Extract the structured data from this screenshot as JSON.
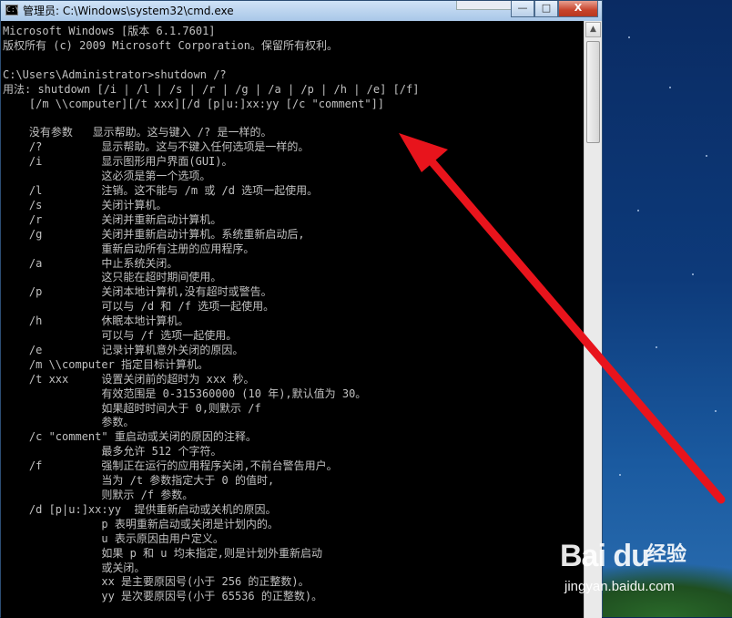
{
  "window": {
    "title": "管理员: C:\\Windows\\system32\\cmd.exe",
    "icon_label": "C:\\",
    "buttons": {
      "minimize": "—",
      "maximize": "□",
      "close": "X"
    }
  },
  "console": {
    "lines": [
      "Microsoft Windows [版本 6.1.7601]",
      "版权所有 (c) 2009 Microsoft Corporation。保留所有权利。",
      "",
      "C:\\Users\\Administrator>shutdown /?",
      "用法: shutdown [/i | /l | /s | /r | /g | /a | /p | /h | /e] [/f]",
      "    [/m \\\\computer][/t xxx][/d [p|u:]xx:yy [/c \"comment\"]]",
      "",
      "    没有参数   显示帮助。这与键入 /? 是一样的。",
      "    /?         显示帮助。这与不键入任何选项是一样的。",
      "    /i         显示图形用户界面(GUI)。",
      "               这必须是第一个选项。",
      "    /l         注销。这不能与 /m 或 /d 选项一起使用。",
      "    /s         关闭计算机。",
      "    /r         关闭并重新启动计算机。",
      "    /g         关闭并重新启动计算机。系统重新启动后,",
      "               重新启动所有注册的应用程序。",
      "    /a         中止系统关闭。",
      "               这只能在超时期间使用。",
      "    /p         关闭本地计算机,没有超时或警告。",
      "               可以与 /d 和 /f 选项一起使用。",
      "    /h         休眠本地计算机。",
      "               可以与 /f 选项一起使用。",
      "    /e         记录计算机意外关闭的原因。",
      "    /m \\\\computer 指定目标计算机。",
      "    /t xxx     设置关闭前的超时为 xxx 秒。",
      "               有效范围是 0-315360000 (10 年),默认值为 30。",
      "               如果超时时间大于 0,则默示 /f",
      "               参数。",
      "    /c \"comment\" 重启动或关闭的原因的注释。",
      "               最多允许 512 个字符。",
      "    /f         强制正在运行的应用程序关闭,不前台警告用户。",
      "               当为 /t 参数指定大于 0 的值时,",
      "               则默示 /f 参数。",
      "    /d [p|u:]xx:yy  提供重新启动或关机的原因。",
      "               p 表明重新启动或关闭是计划内的。",
      "               u 表示原因由用户定义。",
      "               如果 p 和 u 均未指定,则是计划外重新启动",
      "               或关闭。",
      "               xx 是主要原因号(小于 256 的正整数)。",
      "               yy 是次要原因号(小于 65536 的正整数)。"
    ]
  },
  "watermark": {
    "logo": "Bai du",
    "cn": "经验",
    "url": "jingyan.baidu.com"
  },
  "colors": {
    "console_bg": "#000000",
    "console_text": "#c0c0c0",
    "arrow": "#e8141c",
    "titlebar": "#b9d3ee"
  }
}
